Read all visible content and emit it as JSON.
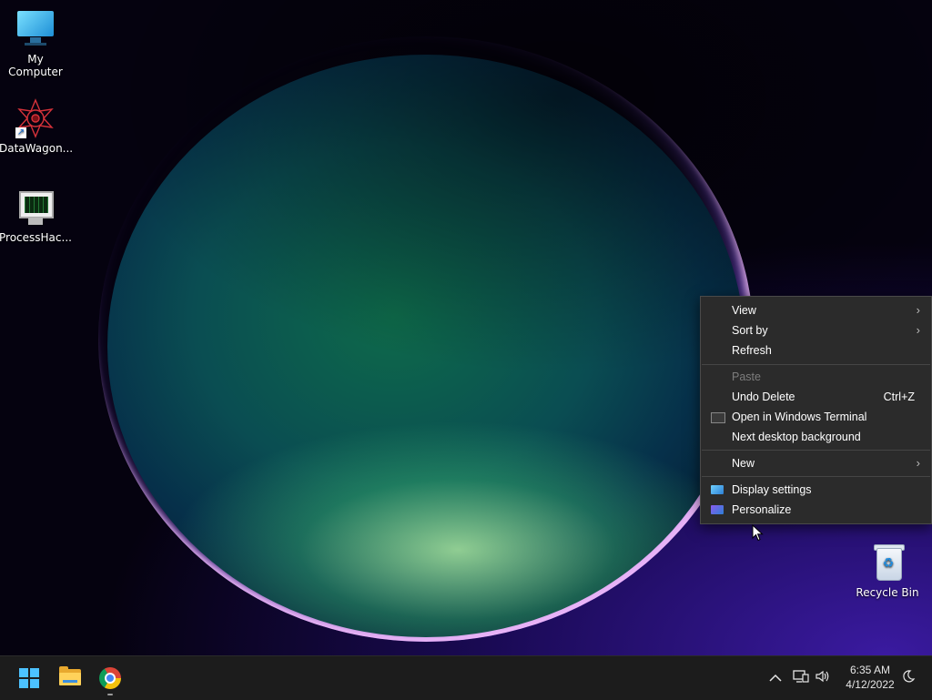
{
  "desktop": {
    "icons": [
      {
        "label": "My Computer"
      },
      {
        "label": "DataWagon..."
      },
      {
        "label": "ProcessHac..."
      },
      {
        "label": "Recycle Bin"
      }
    ]
  },
  "context_menu": {
    "items": [
      {
        "label": "View",
        "has_submenu": true
      },
      {
        "label": "Sort by",
        "has_submenu": true
      },
      {
        "label": "Refresh"
      },
      {
        "label": "Paste",
        "disabled": true
      },
      {
        "label": "Undo Delete",
        "shortcut": "Ctrl+Z"
      },
      {
        "label": "Open in Windows Terminal",
        "icon": "terminal-icon"
      },
      {
        "label": "Next desktop background"
      },
      {
        "label": "New",
        "has_submenu": true
      },
      {
        "label": "Display settings",
        "icon": "display-icon"
      },
      {
        "label": "Personalize",
        "icon": "personalize-icon"
      }
    ],
    "submenu_glyph": "›"
  },
  "taskbar": {
    "apps": [
      "start-icon",
      "file-explorer-icon",
      "chrome-icon"
    ],
    "tray": {
      "chevron_glyph": "^",
      "time": "6:35 AM",
      "date": "4/12/2022"
    }
  },
  "colors": {
    "menu_bg": "#2b2b2b",
    "taskbar_bg": "#1c1c1c",
    "accent": "#4cc2ff"
  }
}
